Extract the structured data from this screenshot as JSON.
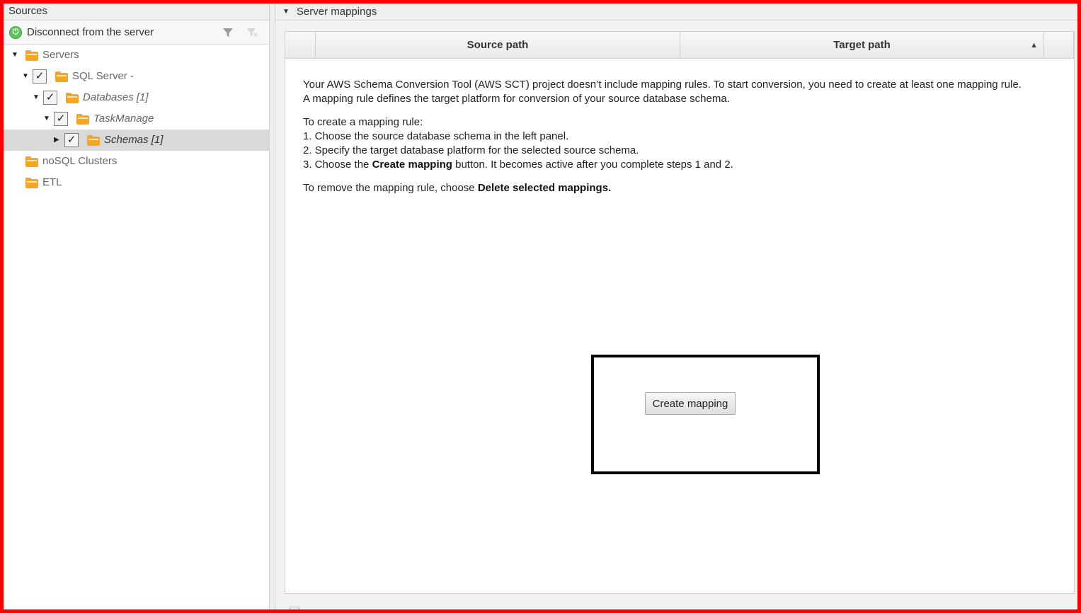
{
  "left_panel": {
    "title": "Sources",
    "toolbar": {
      "disconnect_label": "Disconnect from the server"
    },
    "tree": [
      {
        "label": "Servers"
      },
      {
        "label": "SQL Server -"
      },
      {
        "label": "Databases [1]"
      },
      {
        "label": "TaskManage"
      },
      {
        "label": "Schemas [1]"
      },
      {
        "label": "noSQL Clusters"
      },
      {
        "label": "ETL"
      }
    ]
  },
  "right_panel": {
    "title": "Server mappings",
    "columns": [
      "Source path",
      "Target path"
    ],
    "info": {
      "line1": "Your AWS Schema Conversion Tool (AWS SCT) project doesn’t include mapping rules. To start conversion, you need to create at least one mapping rule.",
      "line2": "A mapping rule defines the target platform for conversion of your source database schema.",
      "steps_intro": "To create a mapping rule:",
      "step1": "1. Choose the source database schema in the left panel.",
      "step2": "2. Specify the target database platform for the selected source schema.",
      "step3_prefix": "3. Choose the ",
      "step3_bold": "Create mapping",
      "step3_suffix": " button. It becomes active after you complete steps 1 and 2.",
      "remove_prefix": "To remove the mapping rule, choose ",
      "remove_bold": "Delete selected mappings."
    },
    "create_button_label": "Create mapping"
  },
  "colors": {
    "folder": "#f5a623",
    "border_highlight": "#ff0000"
  }
}
